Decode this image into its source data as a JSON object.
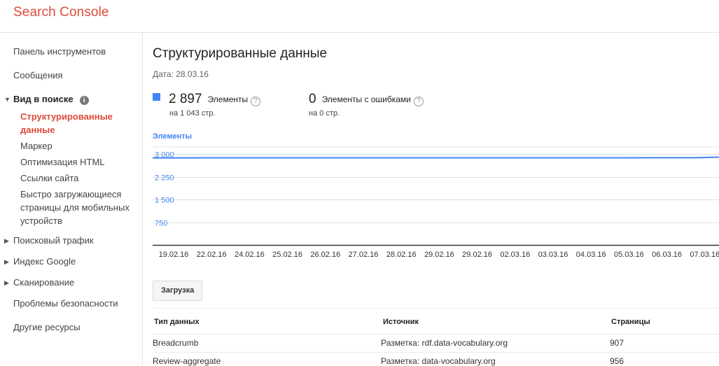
{
  "app": {
    "title": "Search Console"
  },
  "sidebar": {
    "items": [
      {
        "label": "Панель инструментов"
      },
      {
        "label": "Сообщения"
      }
    ],
    "group_search": {
      "label": "Вид в поиске",
      "info_icon": "info-icon",
      "children": [
        {
          "label": "Структурированные данные",
          "active": true
        },
        {
          "label": "Маркер"
        },
        {
          "label": "Оптимизация HTML"
        },
        {
          "label": "Ссылки сайта"
        },
        {
          "label": "Быстро загружающиеся страницы для мобильных устройств"
        }
      ]
    },
    "group_traffic": {
      "label": "Поисковый трафик"
    },
    "group_index": {
      "label": "Индекс Google"
    },
    "group_crawl": {
      "label": "Сканирование"
    },
    "security": {
      "label": "Проблемы безопасности"
    },
    "other": {
      "label": "Другие ресурсы"
    }
  },
  "main": {
    "title": "Структурированные данные",
    "date": "Дата: 28.03.16",
    "metric_items": {
      "value": "2 897",
      "label": "Элементы",
      "sub": "на 1 043 стр."
    },
    "metric_errors": {
      "value": "0",
      "label": "Элементы с ошибками",
      "sub": "на 0 стр."
    },
    "download_label": "Загрузка"
  },
  "chart_data": {
    "type": "line",
    "title": "Элементы",
    "ylim": [
      0,
      3300
    ],
    "yticks": [
      "3 000",
      "2 250",
      "1 500",
      "750"
    ],
    "ytick_values": [
      3000,
      2250,
      1500,
      750
    ],
    "x": [
      "19.02.16",
      "22.02.16",
      "24.02.16",
      "25.02.16",
      "26.02.16",
      "27.02.16",
      "28.02.16",
      "29.02.16",
      "29.02.16",
      "02.03.16",
      "03.03.16",
      "04.03.16",
      "05.03.16",
      "06.03.16",
      "07.03.16"
    ],
    "series": [
      {
        "values": [
          2870,
          2872,
          2873,
          2873,
          2874,
          2874,
          2874,
          2874,
          2874,
          2874,
          2874,
          2874,
          2874,
          2875,
          2876
        ]
      }
    ],
    "end_value": 2897,
    "grid": true,
    "color": "#4285f4"
  },
  "table": {
    "columns": [
      "Тип данных",
      "Источник",
      "Страницы"
    ],
    "rows": [
      [
        "Breadcrumb",
        "Разметка: rdf.data-vocabulary.org",
        "907"
      ],
      [
        "Review-aggregate",
        "Разметка: data-vocabulary.org",
        "956"
      ]
    ]
  },
  "colors": {
    "brand": "#dd4b39",
    "accent": "#4285f4"
  }
}
